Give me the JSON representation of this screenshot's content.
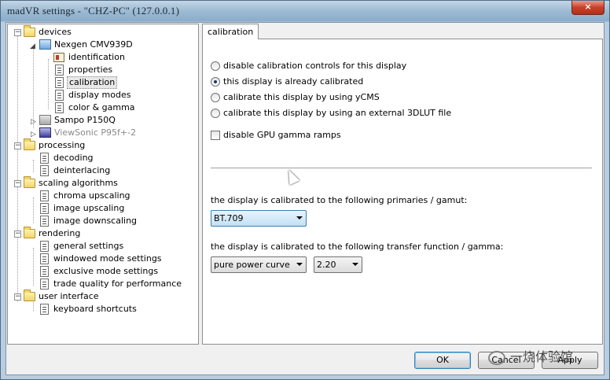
{
  "window": {
    "title": "madVR settings - \"CHZ-PC\" (127.0.0.1)",
    "close_glyph": "×"
  },
  "tree": {
    "nodes": [
      {
        "label": "devices",
        "icon": "folder-icon",
        "expander": "−"
      },
      {
        "label": "Nexgen CMV939D",
        "icon": "monitor-icon",
        "expander": "◢"
      },
      {
        "label": "identification",
        "icon": "id-card-icon"
      },
      {
        "label": "properties",
        "icon": "page-icon"
      },
      {
        "label": "calibration",
        "icon": "page-icon",
        "selected": true
      },
      {
        "label": "display modes",
        "icon": "page-icon"
      },
      {
        "label": "color & gamma",
        "icon": "page-icon"
      },
      {
        "label": "Sampo P150Q",
        "icon": "monitor-icon",
        "expander": "▷"
      },
      {
        "label": "ViewSonic P95f+-2",
        "icon": "monitor-icon",
        "expander": "▷",
        "disabled": true
      },
      {
        "label": "processing",
        "icon": "folder-icon",
        "expander": "−"
      },
      {
        "label": "decoding",
        "icon": "page-icon"
      },
      {
        "label": "deinterlacing",
        "icon": "page-icon"
      },
      {
        "label": "scaling algorithms",
        "icon": "folder-icon",
        "expander": "−"
      },
      {
        "label": "chroma upscaling",
        "icon": "page-icon"
      },
      {
        "label": "image upscaling",
        "icon": "page-icon"
      },
      {
        "label": "image downscaling",
        "icon": "page-icon"
      },
      {
        "label": "rendering",
        "icon": "folder-icon",
        "expander": "−"
      },
      {
        "label": "general settings",
        "icon": "page-icon"
      },
      {
        "label": "windowed mode settings",
        "icon": "page-icon"
      },
      {
        "label": "exclusive mode settings",
        "icon": "page-icon"
      },
      {
        "label": "trade quality for performance",
        "icon": "page-icon"
      },
      {
        "label": "user interface",
        "icon": "folder-icon",
        "expander": "−"
      },
      {
        "label": "keyboard shortcuts",
        "icon": "page-icon"
      }
    ]
  },
  "panel": {
    "tab_label": "calibration",
    "radios": [
      {
        "label": "disable calibration controls for this display",
        "checked": false
      },
      {
        "label": "this display is already calibrated",
        "checked": true
      },
      {
        "label": "calibrate this display by using yCMS",
        "checked": false
      },
      {
        "label": "calibrate this display by using an external 3DLUT file",
        "checked": false
      }
    ],
    "gpu_gamma_checkbox": {
      "label": "disable GPU gamma ramps",
      "checked": false
    },
    "primaries_label": "the display is calibrated to the following primaries / gamut:",
    "primaries_value": "BT.709",
    "transfer_label": "the display is calibrated to the following transfer function / gamma:",
    "transfer_value": "pure power curve",
    "gamma_value": "2.20"
  },
  "buttons": {
    "ok": "OK",
    "cancel": "Cancel",
    "apply": "Apply"
  },
  "watermark": {
    "text": "一烧体验馆"
  }
}
